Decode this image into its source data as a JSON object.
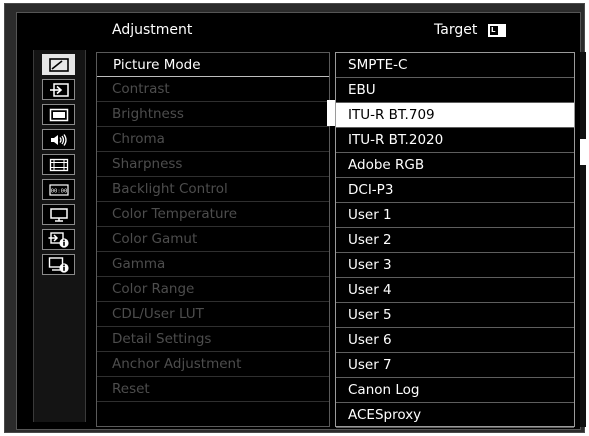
{
  "header": {
    "title": "Adjustment",
    "target_label": "Target",
    "target_icon_letter": "L"
  },
  "sidebar": {
    "icons": [
      {
        "name": "picture-adjust-icon",
        "active": true
      },
      {
        "name": "input-icon",
        "active": false
      },
      {
        "name": "display-icon",
        "active": false
      },
      {
        "name": "audio-icon",
        "active": false
      },
      {
        "name": "marker-icon",
        "active": false
      },
      {
        "name": "timecode-icon",
        "active": false
      },
      {
        "name": "monitor-icon",
        "active": false
      },
      {
        "name": "input-info-icon",
        "active": false
      },
      {
        "name": "monitor-info-icon",
        "active": false
      }
    ]
  },
  "menu": {
    "items": [
      {
        "label": "Picture Mode",
        "enabled": true,
        "selected": true
      },
      {
        "label": "Contrast",
        "enabled": false
      },
      {
        "label": "Brightness",
        "enabled": false
      },
      {
        "label": "Chroma",
        "enabled": false
      },
      {
        "label": "Sharpness",
        "enabled": false
      },
      {
        "label": "Backlight Control",
        "enabled": false
      },
      {
        "label": "Color Temperature",
        "enabled": false
      },
      {
        "label": "Color Gamut",
        "enabled": false
      },
      {
        "label": "Gamma",
        "enabled": false
      },
      {
        "label": "Color Range",
        "enabled": false
      },
      {
        "label": "CDL/User LUT",
        "enabled": false
      },
      {
        "label": "Detail Settings",
        "enabled": false
      },
      {
        "label": "Anchor Adjustment",
        "enabled": false
      },
      {
        "label": "Reset",
        "enabled": false
      }
    ]
  },
  "options": {
    "selected": "ITU-R BT.709",
    "items": [
      "SMPTE-C",
      "EBU",
      "ITU-R BT.709",
      "ITU-R BT.2020",
      "Adobe RGB",
      "DCI-P3",
      "User 1",
      "User 2",
      "User 3",
      "User 4",
      "User 5",
      "User 6",
      "User 7",
      "Canon Log",
      "ACESproxy"
    ]
  },
  "colors": {
    "background": "#000000",
    "frame": "#2b2b2b",
    "text": "#ffffff",
    "disabled_text": "#4d4d4d",
    "highlight": "#ffffff"
  }
}
